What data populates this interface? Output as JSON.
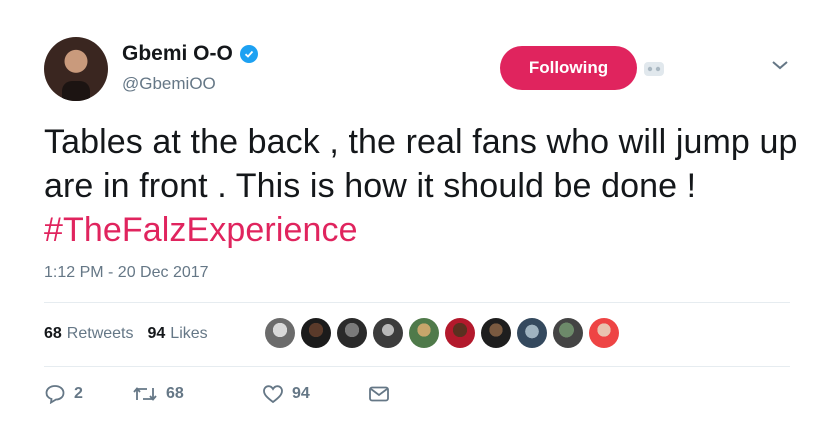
{
  "author": {
    "display_name": "Gbemi O-O",
    "handle": "@GbemiOO",
    "verified": true
  },
  "follow_button": {
    "label": "Following",
    "color": "#e0245e"
  },
  "tweet": {
    "text_before": "Tables at the back , the real fans who will jump up are in front . This is how it should be done ! ",
    "hashtag": "#TheFalzExperience",
    "hashtag_color": "#e0245e",
    "timestamp": "1:12 PM - 20 Dec 2017"
  },
  "stats": {
    "retweets_count": "68",
    "retweets_label": "Retweets",
    "likes_count": "94",
    "likes_label": "Likes"
  },
  "liker_avatars": [
    {
      "icon": "avatar-1"
    },
    {
      "icon": "avatar-2"
    },
    {
      "icon": "avatar-3"
    },
    {
      "icon": "avatar-4"
    },
    {
      "icon": "avatar-5"
    },
    {
      "icon": "avatar-6"
    },
    {
      "icon": "avatar-7"
    },
    {
      "icon": "avatar-8"
    },
    {
      "icon": "avatar-9"
    },
    {
      "icon": "avatar-10"
    }
  ],
  "actions": {
    "reply_count": "2",
    "retweet_count": "68",
    "like_count": "94"
  },
  "icons": {
    "verified": "verified-badge-icon",
    "bot": "bot-icon",
    "menu": "chevron-down-icon",
    "reply": "reply-icon",
    "retweet": "retweet-icon",
    "like": "heart-icon",
    "message": "envelope-icon"
  }
}
